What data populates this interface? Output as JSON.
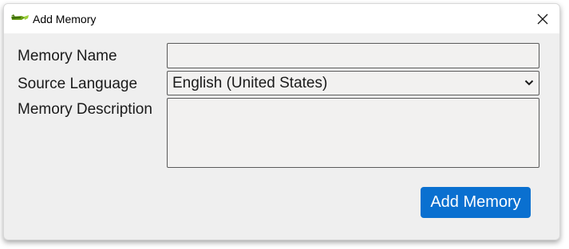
{
  "window": {
    "title": "Add Memory",
    "app_icon": "tool-app-icon",
    "close_icon": "close-icon"
  },
  "form": {
    "memory_name_label": "Memory Name",
    "memory_name_value": "",
    "source_language_label": "Source Language",
    "source_language_value": "English (United States)",
    "memory_description_label": "Memory Description",
    "memory_description_value": ""
  },
  "actions": {
    "submit_label": "Add Memory"
  },
  "colors": {
    "accent": "#0a70d0",
    "window_bg": "#efefef",
    "field_bg": "#f2f1f0",
    "field_border": "#5a5a5a"
  }
}
